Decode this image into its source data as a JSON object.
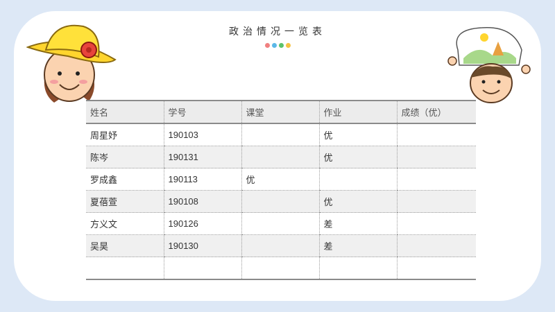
{
  "title": "政治情况一览表",
  "dots": [
    "#f08080",
    "#5bb8e8",
    "#5cc26a",
    "#f5c242"
  ],
  "table": {
    "headers": [
      "姓名",
      "学号",
      "课堂",
      "作业",
      "成绩（优）"
    ],
    "rows": [
      [
        "周星妤",
        "190103",
        "",
        "优",
        ""
      ],
      [
        "陈岑",
        "190131",
        "",
        "优",
        ""
      ],
      [
        "罗成鑫",
        "190113",
        "优",
        "",
        ""
      ],
      [
        "夏蓓萱",
        "190108",
        "",
        "优",
        ""
      ],
      [
        "方义文",
        "190126",
        "",
        "差",
        ""
      ],
      [
        "吴昊",
        "190130",
        "",
        "差",
        ""
      ],
      [
        "",
        "",
        "",
        "",
        ""
      ]
    ]
  },
  "stickers": {
    "left": "girl-with-yellow-hat-icon",
    "right": "boy-holding-drawing-icon"
  }
}
